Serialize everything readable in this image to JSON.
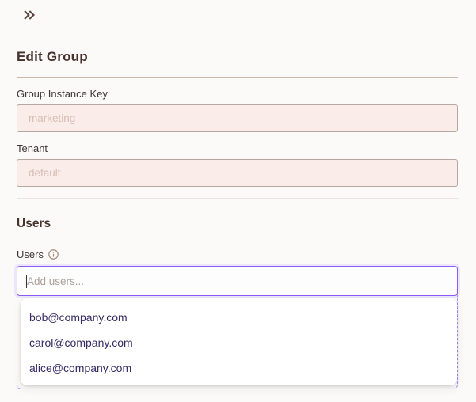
{
  "header": {
    "title": "Edit Group",
    "collapse_icon": "chevrons-right"
  },
  "fields": [
    {
      "label": "Group Instance Key",
      "value": "marketing",
      "state": "disabled"
    },
    {
      "label": "Tenant",
      "value": "default",
      "state": "disabled"
    }
  ],
  "users_section": {
    "heading": "Users",
    "field_label": "Users",
    "info_icon": "info-circle",
    "input_placeholder": "Add users...",
    "dropdown_options": [
      "bob@company.com",
      "carol@company.com",
      "alice@company.com"
    ]
  },
  "colors": {
    "page_background": "#fbfaf9",
    "heading_text": "#45332c",
    "warm_divider": "#cdb6ac",
    "gray_divider": "#e7e4e2",
    "disabled_input_bg": "#f9ece9",
    "disabled_input_border": "#b5a6a1",
    "disabled_input_text": "#d7bcb3",
    "focus_border": "#8b5cf6",
    "dashed_border": "#a78bfa",
    "dropdown_option_text": "#372a66",
    "info_icon_color": "#a68c7f",
    "chevron_icon_color": "#5b463e"
  }
}
